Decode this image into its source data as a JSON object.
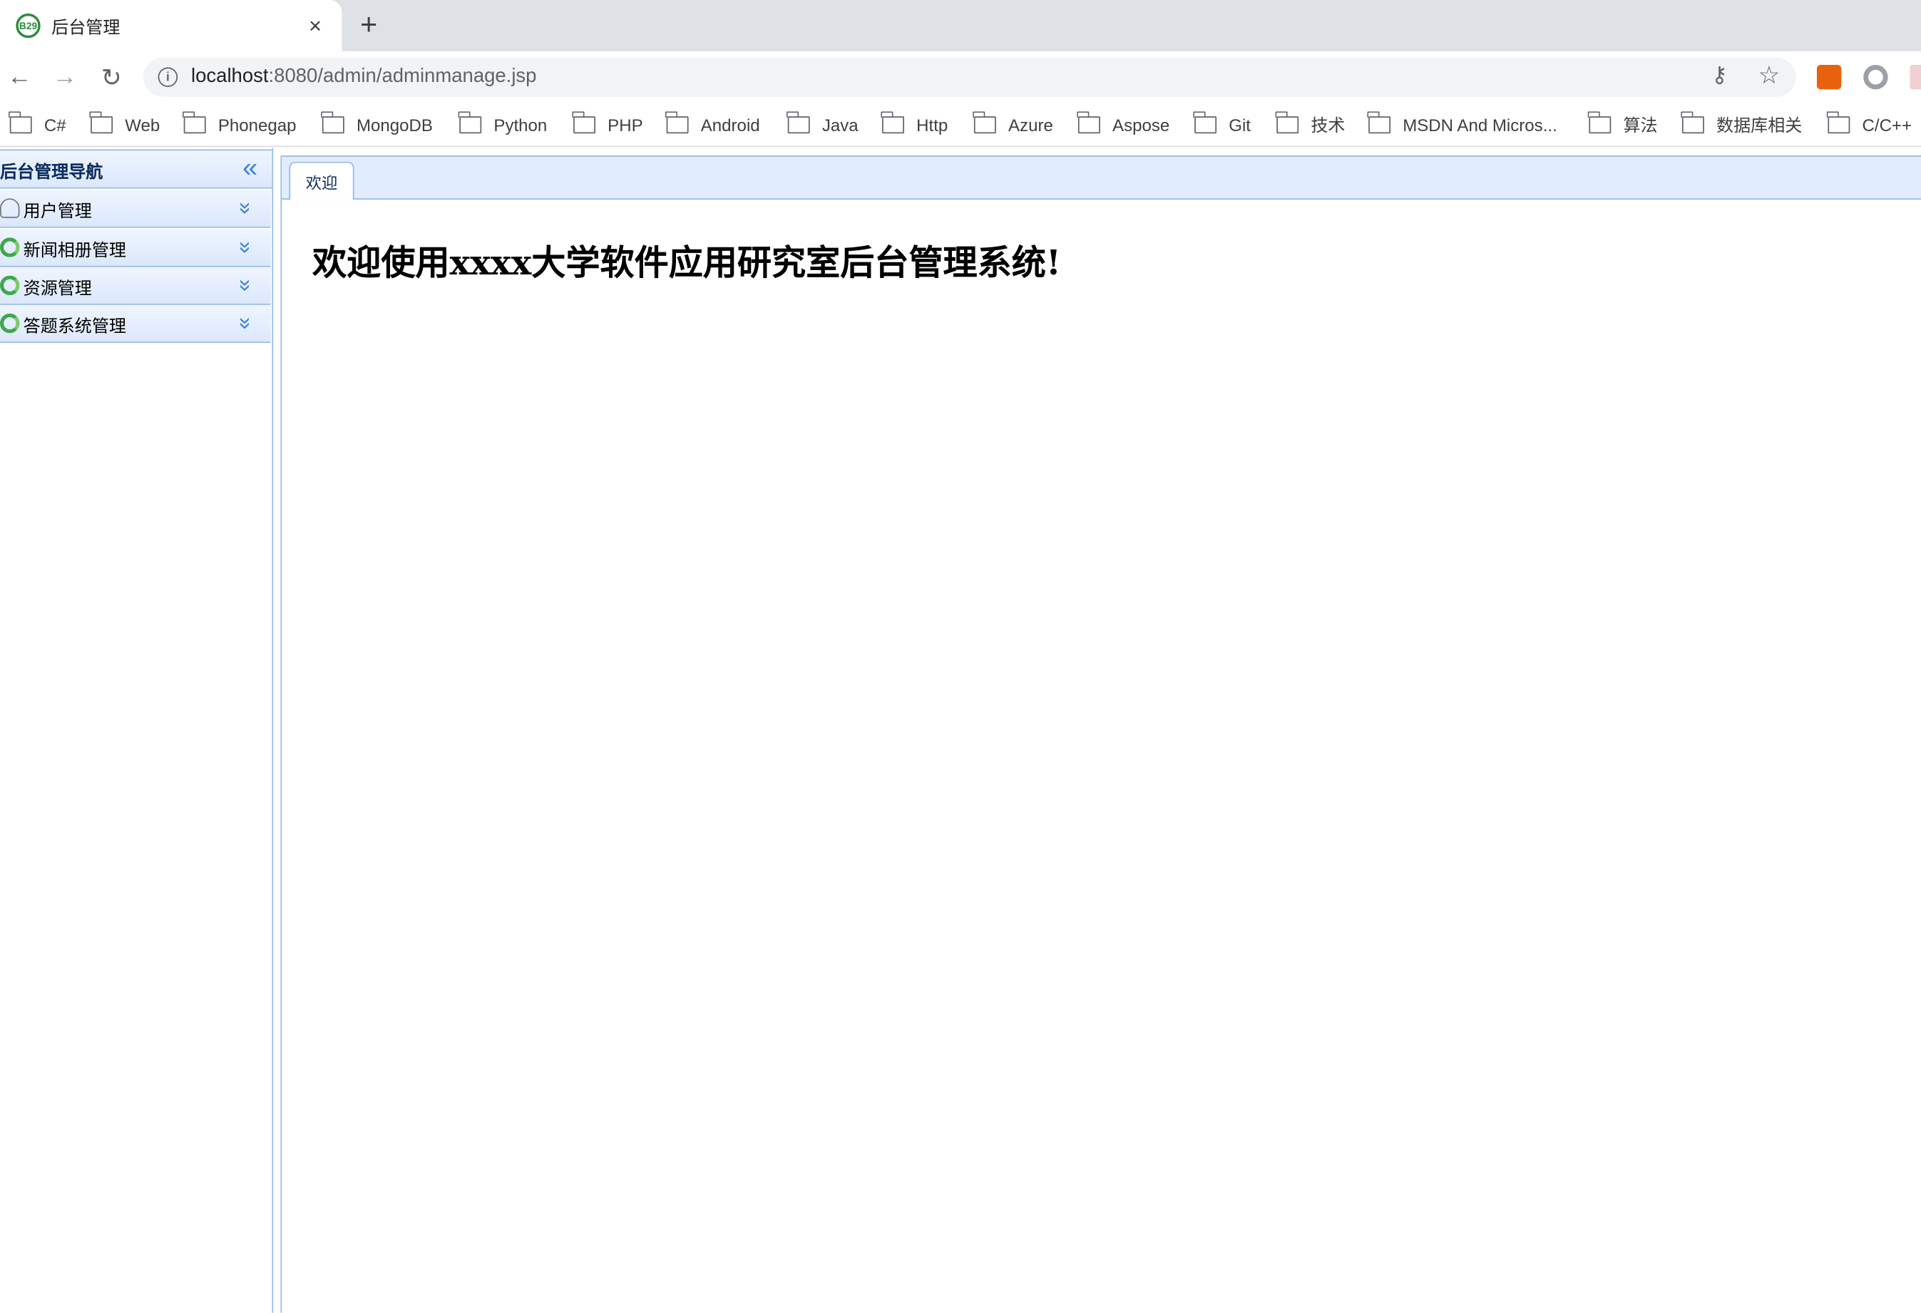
{
  "browser": {
    "tab_title": "后台管理",
    "favicon_text": "B29",
    "close_glyph": "×",
    "new_tab_glyph": "+",
    "url_host": "localhost",
    "url_rest": ":8080/admin/adminmanage.jsp",
    "back_glyph": "←",
    "forward_glyph": "→",
    "reload_glyph": "↻",
    "info_glyph": "i",
    "key_glyph": "⚷",
    "star_glyph": "☆"
  },
  "bookmarks": [
    "C#",
    "Web",
    "Phonegap",
    "MongoDB",
    "Python",
    "PHP",
    "Android",
    "Java",
    "Http",
    "Azure",
    "Aspose",
    "Git",
    "技术",
    "MSDN And Micros...",
    "算法",
    "数据库相关",
    "C/C++"
  ],
  "sidebar": {
    "title": "后台管理导航",
    "collapse_glyph": "«",
    "expand_glyph": "»",
    "items": [
      {
        "label": "用户管理",
        "icon": "user-icon"
      },
      {
        "label": "新闻相册管理",
        "icon": "reload-icon"
      },
      {
        "label": "资源管理",
        "icon": "reload-icon"
      },
      {
        "label": "答题系统管理",
        "icon": "reload-icon"
      }
    ]
  },
  "main": {
    "tab_label": "欢迎",
    "heading": "欢迎使用xxxx大学软件应用研究室后台管理系统!"
  },
  "colors": {
    "panel_border": "#95b8e7",
    "header_bg": "#e0ecff",
    "accent_blue": "#3b83d6"
  }
}
